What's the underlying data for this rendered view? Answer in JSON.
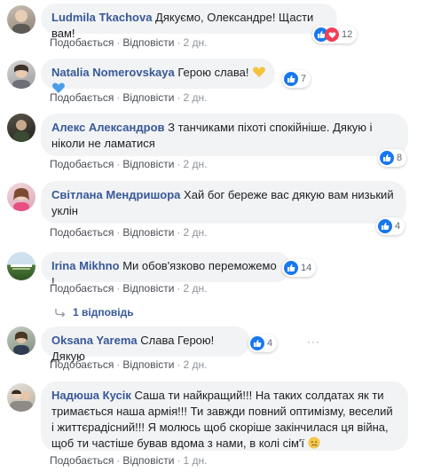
{
  "actions": {
    "like": "Подобається",
    "reply": "Відповісти",
    "sep": "·"
  },
  "comments": [
    {
      "author": "Ludmila Tkachova",
      "text": "Дякуємо, Олександре! Щасти вам!",
      "reactions": "12",
      "time": "2 дн.",
      "reaction_icons": [
        "like-icon",
        "heart-icon"
      ]
    },
    {
      "author": "Natalia Nomerovskaya",
      "text": "Герою слава!",
      "reactions": "7",
      "time": "2 дн.",
      "reaction_icons": [
        "like-icon"
      ],
      "emoji": [
        "yellow-heart",
        "blue-heart"
      ]
    },
    {
      "author": "Алекс Александров",
      "text": "З танчиками піхоті спокійніше. Дякую і ніколи не ламатися",
      "reactions": "8",
      "time": "2 дн.",
      "reaction_icons": [
        "like-icon"
      ]
    },
    {
      "author": "Світлана Мендришора",
      "text": "Хай бог береже вас дякую вам низький уклін",
      "reactions": "4",
      "time": "2 дн.",
      "reaction_icons": [
        "like-icon"
      ]
    },
    {
      "author": "Irina Mikhno",
      "text": "Ми обов'язково переможемо !",
      "reactions": "14",
      "time": "2 дн.",
      "reaction_icons": [
        "like-icon"
      ]
    },
    {
      "author": "Oksana Yarema",
      "text": "Слава Герою!Дякую",
      "reactions": "4",
      "time": "2 дн.",
      "reaction_icons": [
        "like-icon"
      ]
    },
    {
      "author": "Надюша Кусік",
      "text": "Саша ти найкращий!!! На таких солдатах як ти тримається наша армія!!! Ти завжди повний оптимізму, веселий і життєрадісний!!! Я молюсь щоб скоріше закінчилася ця війна, щоб ти частіше бував вдома з нами, в колі сім'ї",
      "reactions": "",
      "time": "1 дн.",
      "reaction_icons": [],
      "emoji": [
        "sad-face"
      ]
    }
  ],
  "replies_link": "1 відповідь",
  "more_dots": "···",
  "colors": {
    "author": "#385898",
    "bubble": "#f2f3f5",
    "like_blue": "#1877f2",
    "meta": "#90949c"
  }
}
